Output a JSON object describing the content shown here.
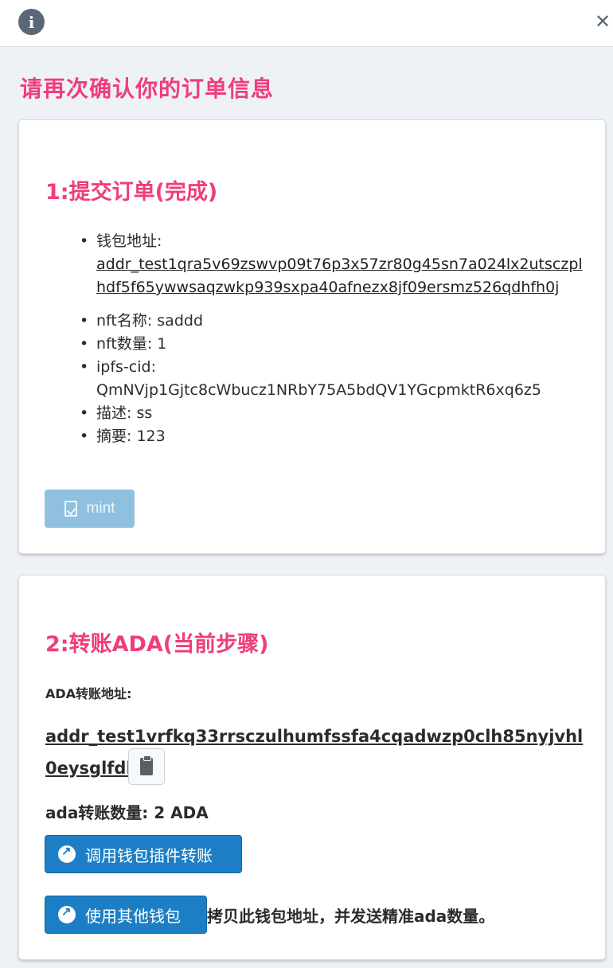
{
  "page_title": "请再次确认你的订单信息",
  "step1": {
    "title": "1:提交订单(完成)",
    "wallet_label": "钱包地址:",
    "wallet_address": "addr_test1qra5v69zswvp09t76p3x57zr80g45sn7a024lx2utsczplhdf5f65ywwsaqzwkp939sxpa40afnezx8jf09ersmz526qdhfh0j",
    "nft_name": "nft名称: saddd",
    "nft_count": "nft数量: 1",
    "ipfs_label": "ipfs-cid:",
    "ipfs_cid": "QmNVjp1Gjtc8cWbucz1NRbY75A5bdQV1YGcpmktR6xq6z5",
    "description": "描述: ss",
    "summary": "摘要: 123",
    "mint_label": "mint"
  },
  "step2": {
    "title": "2:转账ADA(当前步骤)",
    "address_label": "ADA转账地址:",
    "address": "addr_test1vrfkq33rrsczulhumfssfa4cqadwzp0clh85nyjvhl0eysglfdkvs",
    "amount": "ada转账数量: 2 ADA",
    "plugin_button": "调用钱包插件转账",
    "other_wallet_button": "使用其他钱包",
    "other_wallet_hint": "拷贝此钱包地址，并发送精准ada数量。"
  },
  "icons": {
    "info": "info-icon",
    "close": "close-icon",
    "copy": "clipboard-icon",
    "mint": "file-check-icon",
    "wallet": "external-link-icon"
  },
  "colors": {
    "accent": "#ef3d7d",
    "primary_button": "#1c7fc6",
    "disabled_button": "#8fc0e0"
  }
}
